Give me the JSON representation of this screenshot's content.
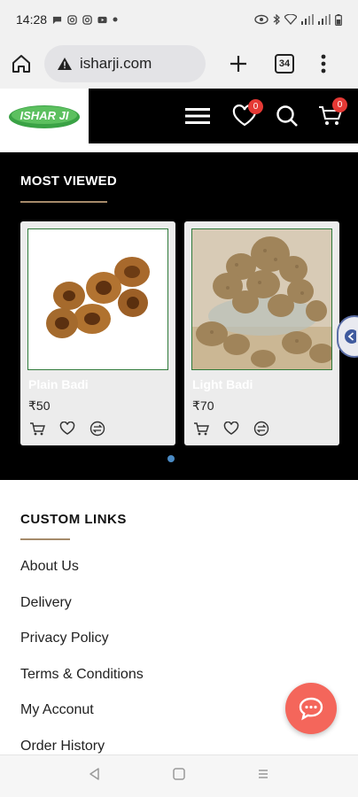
{
  "status_bar": {
    "time": "14:28",
    "left_icons": [
      "chat-icon",
      "instagram-icon",
      "instagram-icon",
      "youtube-icon",
      "dot-icon"
    ],
    "right_icons": [
      "eye-icon",
      "bluetooth-icon",
      "wifi-icon",
      "signal-icon",
      "signal-icon",
      "battery-icon"
    ]
  },
  "browser": {
    "url": "isharji.com",
    "tab_count": "34"
  },
  "header": {
    "logo_text": "ISHAR JI",
    "wishlist_count": "0",
    "cart_count": "0"
  },
  "most_viewed": {
    "title": "MOST VIEWED",
    "products": [
      {
        "name": "Plain Badi",
        "price": "₹50"
      },
      {
        "name": "Light Badi",
        "price": "₹70"
      }
    ]
  },
  "custom_links": {
    "title": "CUSTOM LINKS",
    "links": [
      "About Us",
      "Delivery",
      "Privacy Policy",
      "Terms & Conditions",
      "My Acconut",
      "Order History"
    ]
  },
  "colors": {
    "header_bg": "#000000",
    "badge": "#e53935",
    "accent_underline": "#a58a6a",
    "chat_fab": "#f4665b",
    "carousel_dot": "#4a8ac4"
  }
}
